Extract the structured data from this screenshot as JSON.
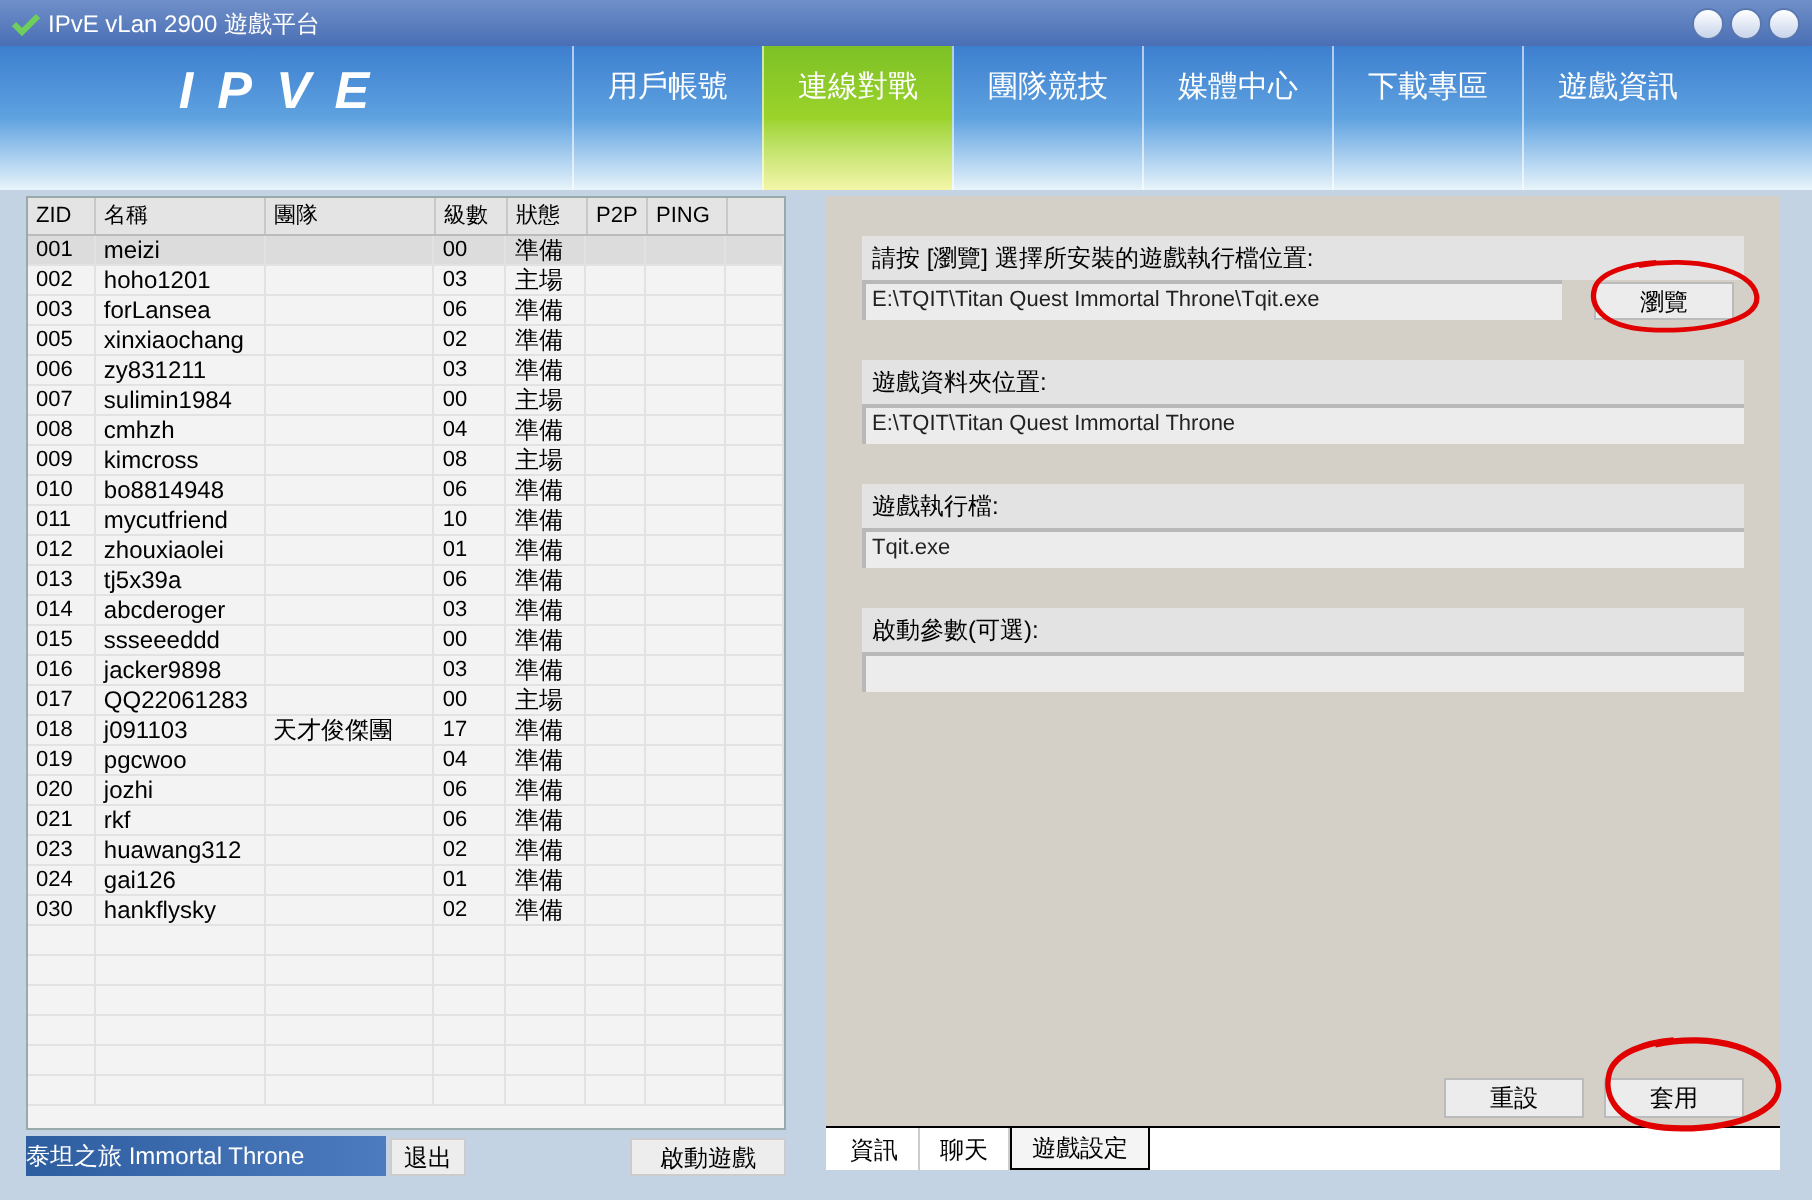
{
  "window": {
    "title": "IPvE vLan 2900 遊戲平台"
  },
  "logo": "IPVE",
  "nav": [
    {
      "label": "用戶帳號",
      "selected": false
    },
    {
      "label": "連線對戰",
      "selected": true
    },
    {
      "label": "團隊競技",
      "selected": false
    },
    {
      "label": "媒體中心",
      "selected": false
    },
    {
      "label": "下載專區",
      "selected": false
    },
    {
      "label": "遊戲資訊",
      "selected": false
    }
  ],
  "table": {
    "columns": [
      "ZID",
      "名稱",
      "團隊",
      "級數",
      "狀態",
      "P2P",
      "PING"
    ],
    "rows": [
      {
        "cells": [
          "001",
          "meizi",
          "",
          "00",
          "準備"
        ],
        "selected": true
      },
      {
        "cells": [
          "002",
          "hoho1201",
          "",
          "03",
          "主場"
        ],
        "selected": false
      },
      {
        "cells": [
          "003",
          "forLansea",
          "",
          "06",
          "準備"
        ],
        "selected": false
      },
      {
        "cells": [
          "005",
          "xinxiaochang",
          "",
          "02",
          "準備"
        ],
        "selected": false
      },
      {
        "cells": [
          "006",
          "zy831211",
          "",
          "03",
          "準備"
        ],
        "selected": false
      },
      {
        "cells": [
          "007",
          "sulimin1984",
          "",
          "00",
          "主場"
        ],
        "selected": false
      },
      {
        "cells": [
          "008",
          "cmhzh",
          "",
          "04",
          "準備"
        ],
        "selected": false
      },
      {
        "cells": [
          "009",
          "kimcross",
          "",
          "08",
          "主場"
        ],
        "selected": false
      },
      {
        "cells": [
          "010",
          "bo8814948",
          "",
          "06",
          "準備"
        ],
        "selected": false
      },
      {
        "cells": [
          "011",
          "mycutfriend",
          "",
          "10",
          "準備"
        ],
        "selected": false
      },
      {
        "cells": [
          "012",
          "zhouxiaolei",
          "",
          "01",
          "準備"
        ],
        "selected": false
      },
      {
        "cells": [
          "013",
          "tj5x39a",
          "",
          "06",
          "準備"
        ],
        "selected": false
      },
      {
        "cells": [
          "014",
          "abcderoger",
          "",
          "03",
          "準備"
        ],
        "selected": false
      },
      {
        "cells": [
          "015",
          "ssseeeddd",
          "",
          "00",
          "準備"
        ],
        "selected": false
      },
      {
        "cells": [
          "016",
          "jacker9898",
          "",
          "03",
          "準備"
        ],
        "selected": false
      },
      {
        "cells": [
          "017",
          "QQ22061283",
          "",
          "00",
          "主場"
        ],
        "selected": false
      },
      {
        "cells": [
          "018",
          "j091103",
          "天才俊傑團",
          "17",
          "準備"
        ],
        "selected": false
      },
      {
        "cells": [
          "019",
          "pgcwoo",
          "",
          "04",
          "準備"
        ],
        "selected": false
      },
      {
        "cells": [
          "020",
          "jozhi",
          "",
          "06",
          "準備"
        ],
        "selected": false
      },
      {
        "cells": [
          "021",
          "rkf",
          "",
          "06",
          "準備"
        ],
        "selected": false
      },
      {
        "cells": [
          "023",
          "huawang312",
          "",
          "02",
          "準備"
        ],
        "selected": false
      },
      {
        "cells": [
          "024",
          "gai126",
          "",
          "01",
          "準備"
        ],
        "selected": false
      },
      {
        "cells": [
          "030",
          "hankflysky",
          "",
          "02",
          "準備"
        ],
        "selected": false
      }
    ]
  },
  "game_select": {
    "value": "泰坦之旅 Immortal Throne"
  },
  "exit_button": "退出",
  "launch_button": "啟動遊戲",
  "settings": {
    "exe_prompt": "請按 [瀏覽] 選擇所安裝的遊戲執行檔位置:",
    "exe_path": "E:\\TQIT\\Titan Quest Immortal Throne\\Tqit.exe",
    "browse_button": "瀏覽",
    "folder_label": "遊戲資料夾位置:",
    "folder_path": "E:\\TQIT\\Titan Quest Immortal Throne",
    "exe_label": "遊戲執行檔:",
    "exe_name": "Tqit.exe",
    "params_label": "啟動參數(可選):",
    "reset_button": "重設",
    "apply_button": "套用"
  },
  "tabs": [
    {
      "label": "資訊",
      "selected": false
    },
    {
      "label": "聊天",
      "selected": false
    },
    {
      "label": "遊戲設定",
      "selected": true
    }
  ]
}
